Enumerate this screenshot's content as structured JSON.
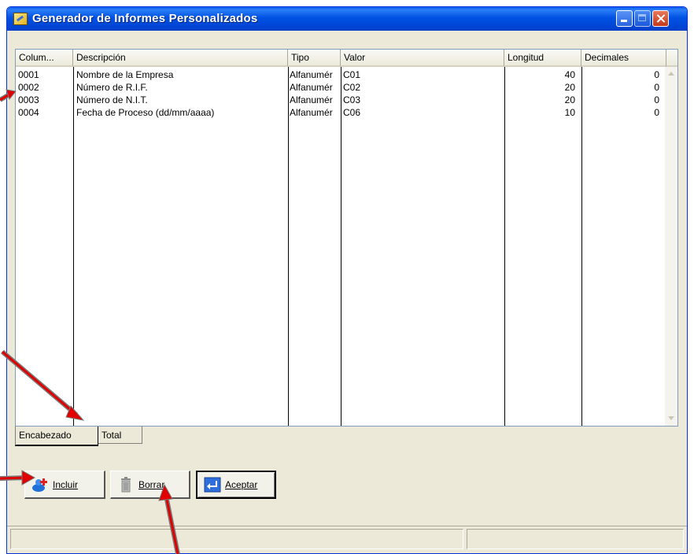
{
  "window": {
    "title": "Generador de Informes Personalizados"
  },
  "grid": {
    "headers": [
      "Colum...",
      "Descripción",
      "Tipo",
      "Valor",
      "Longitud",
      "Decimales"
    ],
    "rows": [
      {
        "col": "0001",
        "desc": "Nombre de la Empresa",
        "tipo": "Alfanumér",
        "valor": "C01",
        "longitud": "40",
        "decimales": "0"
      },
      {
        "col": "0002",
        "desc": "Número de R.I.F.",
        "tipo": "Alfanumér",
        "valor": "C02",
        "longitud": "20",
        "decimales": "0"
      },
      {
        "col": "0003",
        "desc": "Número de N.I.T.",
        "tipo": "Alfanumér",
        "valor": "C03",
        "longitud": "20",
        "decimales": "0"
      },
      {
        "col": "0004",
        "desc": "Fecha de Proceso (dd/mm/aaaa)",
        "tipo": "Alfanumér",
        "valor": "C06",
        "longitud": "10",
        "decimales": "0"
      }
    ]
  },
  "tabs": [
    {
      "label": "Encabezado",
      "active": true
    },
    {
      "label": "Total",
      "active": false
    }
  ],
  "buttons": {
    "incluir": "Incluir",
    "borrar": "Borrar",
    "aceptar": "Aceptar"
  },
  "colors": {
    "titlebar": "#0052e4",
    "annotation_arrow": "#e00000",
    "annotation_outline": "#7a7a7a"
  },
  "icons": {
    "app": "report-icon",
    "incluir": "add-user-icon",
    "borrar": "trash-icon",
    "aceptar": "enter-arrow-icon"
  }
}
